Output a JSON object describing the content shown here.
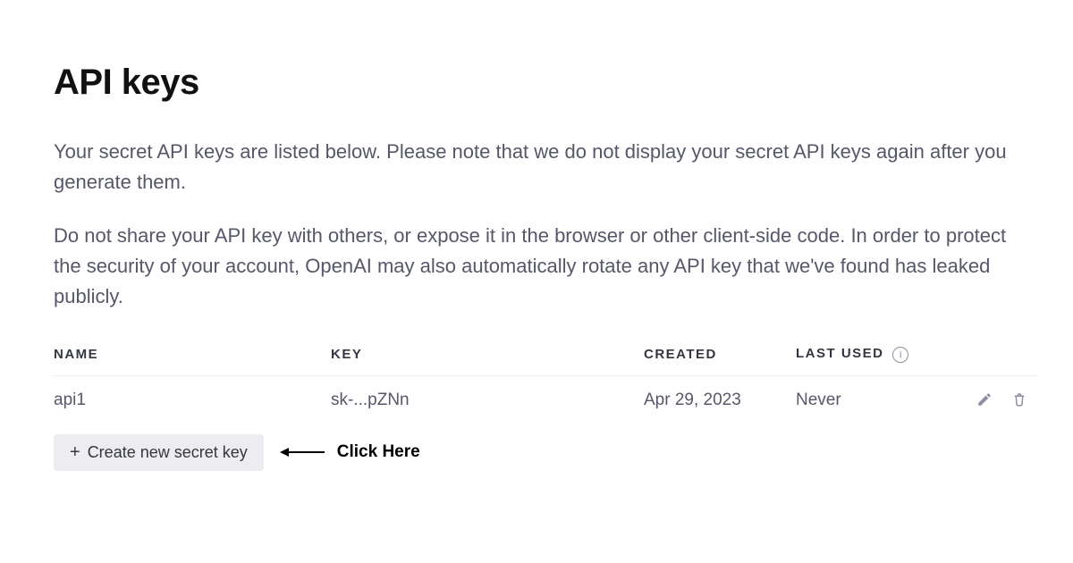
{
  "page": {
    "title": "API keys",
    "description1": "Your secret API keys are listed below. Please note that we do not display your secret API keys again after you generate them.",
    "description2": "Do not share your API key with others, or expose it in the browser or other client-side code. In order to protect the security of your account, OpenAI may also automatically rotate any API key that we've found has leaked publicly."
  },
  "table": {
    "headers": {
      "name": "NAME",
      "key": "KEY",
      "created": "CREATED",
      "last_used": "LAST USED"
    },
    "rows": [
      {
        "name": "api1",
        "key": "sk-...pZNn",
        "created": "Apr 29, 2023",
        "last_used": "Never"
      }
    ]
  },
  "actions": {
    "create_label": "Create new secret key"
  },
  "annotation": {
    "text": "Click Here"
  }
}
